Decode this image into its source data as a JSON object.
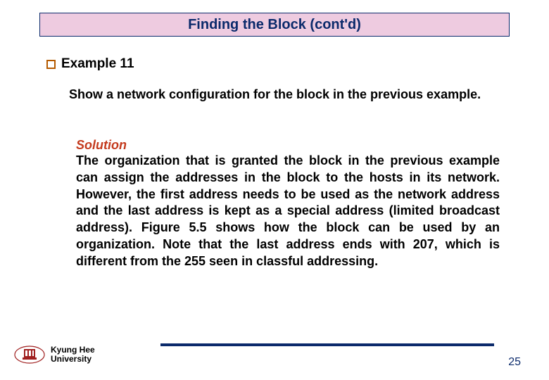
{
  "title": "Finding the Block (cont'd)",
  "example": {
    "label": "Example 11",
    "prompt": "Show a network configuration for the block in the previous example."
  },
  "solution": {
    "label": "Solution",
    "body_before_hl": "The organization that is granted the block in the previous example can assign the addresses in the block to the hosts in its network. However, ",
    "highlight": "the first address needs to be used as the network address",
    "body_after_hl": " and the last address is kept as a special address (limited broadcast address). Figure 5.5 shows how the block can be used by an organization. Note that the last address ends with 207, which is different from the 255 seen in classful addressing."
  },
  "footer": {
    "university_line1": "Kyung Hee",
    "university_line2": "University",
    "page_number": "25"
  }
}
